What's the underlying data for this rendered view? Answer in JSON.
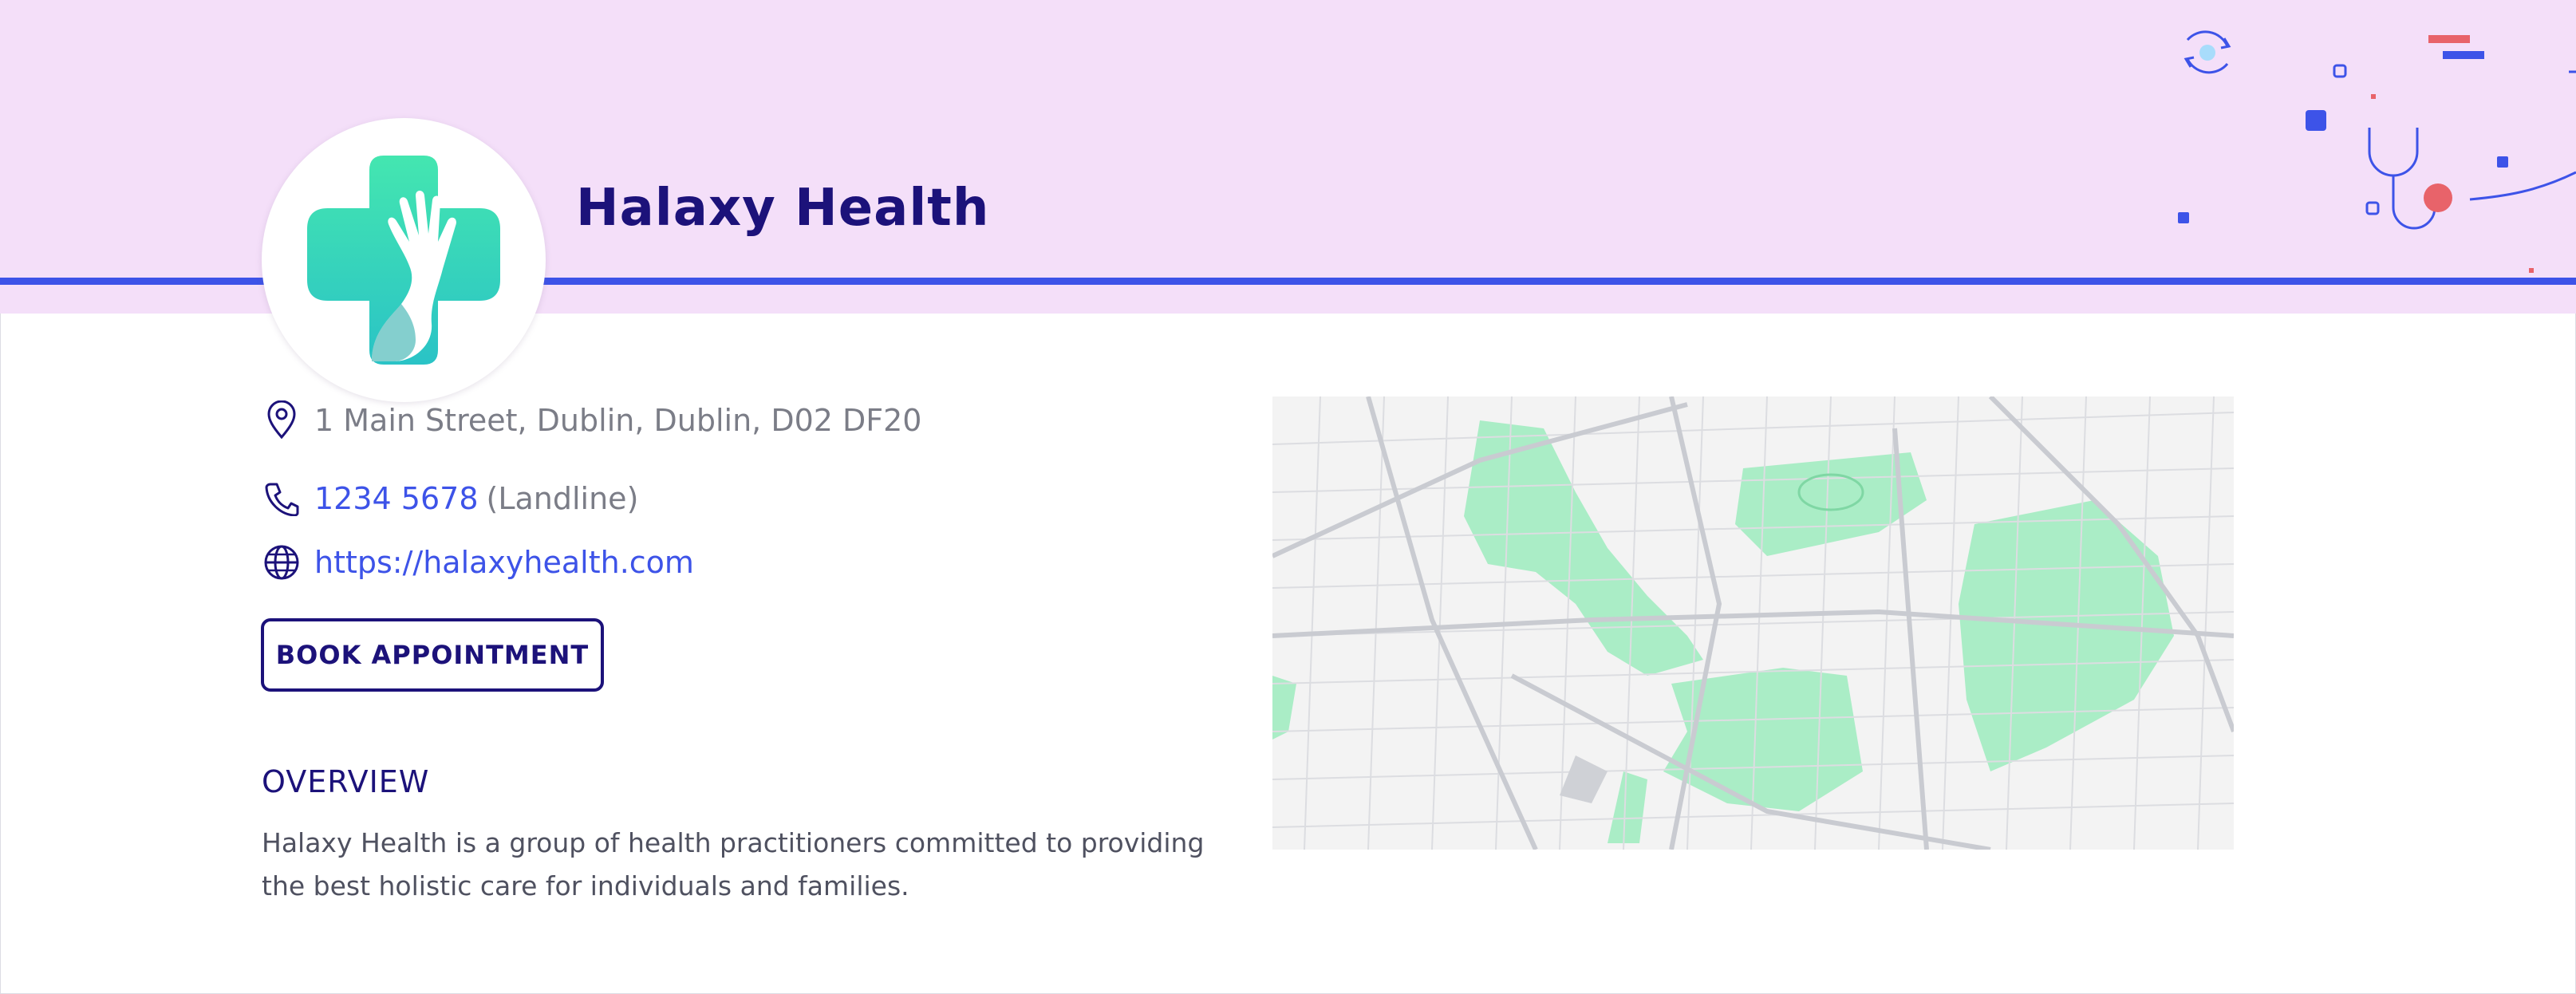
{
  "colors": {
    "banner_bg": "#f4dff9",
    "accent_blue": "#3d53e8",
    "title_navy": "#1c127a",
    "logo_green": "#3fe0ad",
    "logo_teal": "#2cc5c4",
    "decor_red": "#e8636a",
    "map_green": "#a9ecc4"
  },
  "header": {
    "title": "Halaxy Health",
    "logo_icon": "cross-hand-logo"
  },
  "contact": {
    "address": "1 Main Street, Dublin, Dublin, D02 DF20",
    "address_icon": "location-pin-icon",
    "phone": "1234 5678",
    "phone_type": "(Landline)",
    "phone_icon": "phone-icon",
    "website": "https://halaxyhealth.com",
    "website_icon": "globe-icon"
  },
  "actions": {
    "book_label": "BOOK APPOINTMENT"
  },
  "overview": {
    "heading": "OVERVIEW",
    "text_line1": "Halaxy Health is a group of health practitioners committed to providing",
    "text_line2": "the best holistic care for individuals and families."
  },
  "map": {
    "icon": "street-map"
  }
}
